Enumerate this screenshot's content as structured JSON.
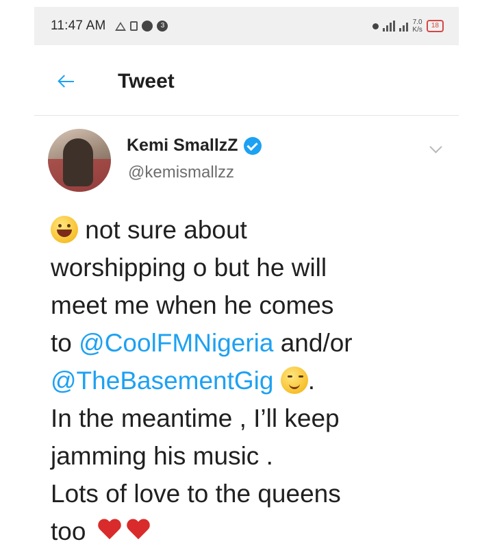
{
  "status_bar": {
    "time": "11:47 AM",
    "badge": "3",
    "speed_top": "7.0",
    "speed_bottom": "K/s",
    "battery": "18"
  },
  "header": {
    "title": "Tweet"
  },
  "tweet": {
    "display_name": "Kemi SmallzZ",
    "handle": "@kemismallzz",
    "text_lines": [
      " not sure about",
      "worshipping o but he will",
      "meet me when he comes",
      "to ",
      "@CoolFMNigeria",
      "  and/or",
      "@TheBasementGig",
      ".",
      "In the meantime , I’ll keep",
      "jamming his music .",
      "Lots of love to the queens",
      "too "
    ]
  },
  "colors": {
    "link": "#1da1f2",
    "verified": "#1da1f2",
    "heart": "#d92b2b",
    "battery": "#d64545"
  }
}
